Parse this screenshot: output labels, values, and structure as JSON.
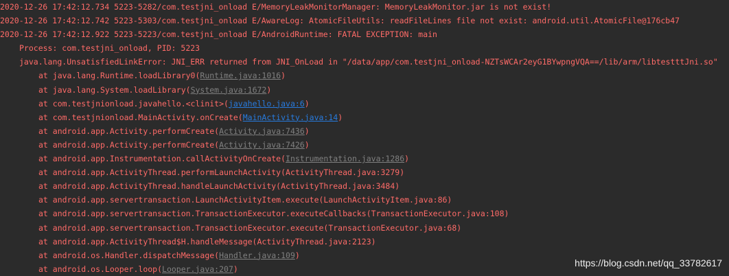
{
  "log": {
    "lines": [
      {
        "indent": 0,
        "pre": "2020-12-26 17:42:12.734 5223-5282/com.testjni_onload E/MemoryLeakMonitorManager: MemoryLeakMonitor.jar is not exist!",
        "link": "",
        "link_style": "",
        "post": ""
      },
      {
        "indent": 0,
        "pre": "2020-12-26 17:42:12.742 5223-5303/com.testjni_onload E/AwareLog: AtomicFileUtils: readFileLines file not exist: android.util.AtomicFile@176cb47",
        "link": "",
        "link_style": "",
        "post": ""
      },
      {
        "indent": 0,
        "pre": "2020-12-26 17:42:12.922 5223-5223/com.testjni_onload E/AndroidRuntime: FATAL EXCEPTION: main",
        "link": "",
        "link_style": "",
        "post": ""
      },
      {
        "indent": 4,
        "pre": "Process: com.testjni_onload, PID: 5223",
        "link": "",
        "link_style": "",
        "post": ""
      },
      {
        "indent": 4,
        "pre": "java.lang.UnsatisfiedLinkError: JNI_ERR returned from JNI_OnLoad in \"/data/app/com.testjni_onload-NZTsWCAr2eyG1BYwpngVQA==/lib/arm/libtestttJni.so\"",
        "link": "",
        "link_style": "",
        "post": ""
      },
      {
        "indent": 8,
        "pre": "at java.lang.Runtime.loadLibrary0(",
        "link": "Runtime.java:1016",
        "link_style": "gray",
        "post": ")"
      },
      {
        "indent": 8,
        "pre": "at java.lang.System.loadLibrary(",
        "link": "System.java:1672",
        "link_style": "gray",
        "post": ")"
      },
      {
        "indent": 8,
        "pre": "at com.testjnionload.javahello.<clinit>(",
        "link": "javahello.java:6",
        "link_style": "blue",
        "post": ")"
      },
      {
        "indent": 8,
        "pre": "at com.testjnionload.MainActivity.onCreate(",
        "link": "MainActivity.java:14",
        "link_style": "blue",
        "post": ")"
      },
      {
        "indent": 8,
        "pre": "at android.app.Activity.performCreate(",
        "link": "Activity.java:7436",
        "link_style": "gray",
        "post": ")"
      },
      {
        "indent": 8,
        "pre": "at android.app.Activity.performCreate(",
        "link": "Activity.java:7426",
        "link_style": "gray",
        "post": ")"
      },
      {
        "indent": 8,
        "pre": "at android.app.Instrumentation.callActivityOnCreate(",
        "link": "Instrumentation.java:1286",
        "link_style": "gray",
        "post": ")"
      },
      {
        "indent": 8,
        "pre": "at android.app.ActivityThread.performLaunchActivity(ActivityThread.java:3279)",
        "link": "",
        "link_style": "",
        "post": ""
      },
      {
        "indent": 8,
        "pre": "at android.app.ActivityThread.handleLaunchActivity(ActivityThread.java:3484)",
        "link": "",
        "link_style": "",
        "post": ""
      },
      {
        "indent": 8,
        "pre": "at android.app.servertransaction.LaunchActivityItem.execute(LaunchActivityItem.java:86)",
        "link": "",
        "link_style": "",
        "post": ""
      },
      {
        "indent": 8,
        "pre": "at android.app.servertransaction.TransactionExecutor.executeCallbacks(TransactionExecutor.java:108)",
        "link": "",
        "link_style": "",
        "post": ""
      },
      {
        "indent": 8,
        "pre": "at android.app.servertransaction.TransactionExecutor.execute(TransactionExecutor.java:68)",
        "link": "",
        "link_style": "",
        "post": ""
      },
      {
        "indent": 8,
        "pre": "at android.app.ActivityThread$H.handleMessage(ActivityThread.java:2123)",
        "link": "",
        "link_style": "",
        "post": ""
      },
      {
        "indent": 8,
        "pre": "at android.os.Handler.dispatchMessage(",
        "link": "Handler.java:109",
        "link_style": "gray",
        "post": ")"
      },
      {
        "indent": 8,
        "pre": "at android.os.Looper.loop(",
        "link": "Looper.java:207",
        "link_style": "gray",
        "post": ")"
      }
    ]
  },
  "watermark": "https://blog.csdn.net/qq_33782617",
  "colors": {
    "background": "#2b2b2b",
    "error_text": "#ff6b68",
    "link_gray": "#808080",
    "link_blue": "#287bde",
    "watermark": "#ffffff"
  }
}
